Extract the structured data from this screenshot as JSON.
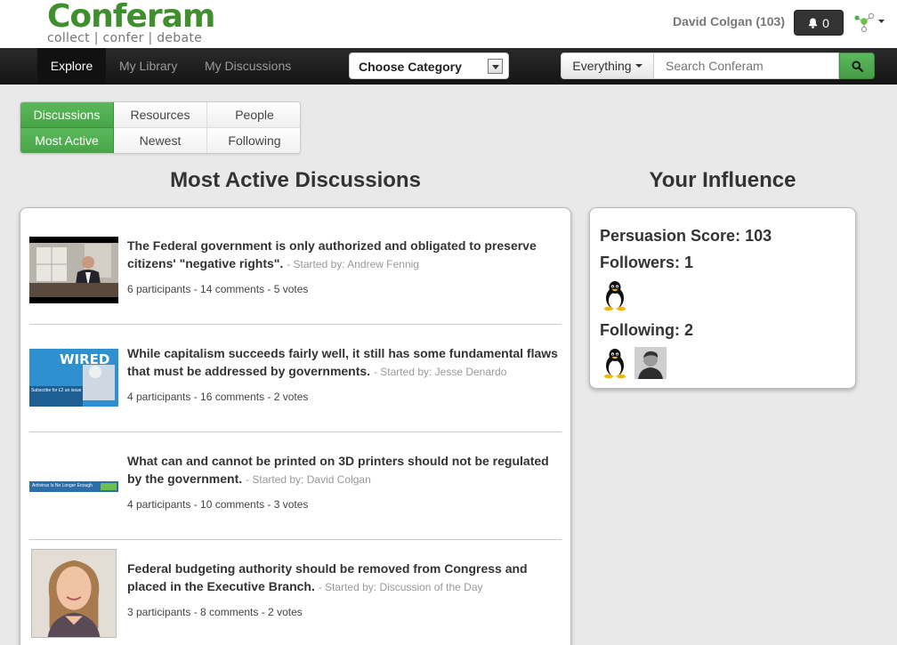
{
  "brand": {
    "name": "Conferam",
    "tagline": "collect | confer | debate"
  },
  "header": {
    "user": "David Colgan (103)",
    "notifications": "0"
  },
  "nav": {
    "items": [
      {
        "label": "Explore",
        "active": true
      },
      {
        "label": "My Library"
      },
      {
        "label": "My Discussions"
      }
    ],
    "category_label": "Choose Category",
    "scope_label": "Everything",
    "search_placeholder": "Search Conferam"
  },
  "tabs": {
    "row1": [
      "Discussions",
      "Resources",
      "People"
    ],
    "row2": [
      "Most Active",
      "Newest",
      "Following"
    ]
  },
  "main": {
    "heading": "Most Active Discussions",
    "discussions": [
      {
        "title": "The Federal government is only authorized and obligated to preserve citizens' \"negative rights\".",
        "starter": "- Started by: Andrew Fennig",
        "meta": "6 participants - 14 comments - 5 votes",
        "thumb": "video-thumbnail"
      },
      {
        "title": "While capitalism succeeds fairly well, it still has some fundamental flaws that must be addressed by governments.",
        "starter": "- Started by: Jesse Denardo",
        "meta": "4 participants - 16 comments - 2 votes",
        "thumb": "wired-magazine-thumbnail",
        "thumb_text": "WIRED",
        "thumb_caption": "Subscribe for £2 an issue"
      },
      {
        "title": "What can and cannot be printed on 3D printers should not be regulated by the government.",
        "starter": "- Started by: David Colgan",
        "meta": "4 participants - 10 comments - 3 votes",
        "thumb": "banner-thumbnail",
        "thumb_text": "Antivirus Is No Longer Enough"
      },
      {
        "title": "Federal budgeting authority should be removed from Congress and placed in the Executive Branch.",
        "starter": "- Started by: Discussion of the Day",
        "meta": "3 participants - 8 comments - 2 votes",
        "thumb": "portrait-thumbnail"
      }
    ]
  },
  "influence": {
    "heading": "Your Influence",
    "score": "Persuasion Score: 103",
    "followers": "Followers: 1",
    "following": "Following: 2"
  },
  "colors": {
    "brand_green": "#3f8f2f",
    "button_green": "#5cb85c",
    "navbar": "#1c1c1c"
  }
}
